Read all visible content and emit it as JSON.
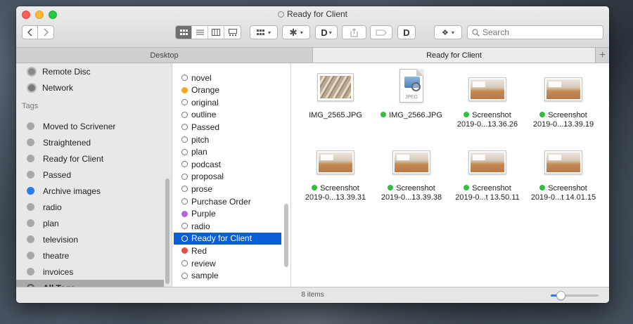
{
  "window": {
    "title": "Ready for Client"
  },
  "toolbar": {
    "back_icon": "chevron-left-icon",
    "forward_icon": "chevron-right-icon",
    "view_modes": [
      "icon-view",
      "list-view",
      "column-view",
      "gallery-view"
    ],
    "active_view": "icon-view",
    "search": {
      "placeholder": "Search",
      "value": ""
    }
  },
  "tabs": [
    {
      "label": "Desktop",
      "active": false
    },
    {
      "label": "Ready for Client",
      "active": true
    }
  ],
  "sidebar": {
    "top_items": [
      {
        "label": "Remote Disc",
        "icon": "disc-icon"
      },
      {
        "label": "Network",
        "icon": "globe-icon"
      }
    ],
    "tags_header": "Tags",
    "tags": [
      {
        "label": "Moved to Scrivener",
        "color": "#a8a8a8"
      },
      {
        "label": "Straightened",
        "color": "#a8a8a8"
      },
      {
        "label": "Ready for Client",
        "color": "#a8a8a8"
      },
      {
        "label": "Passed",
        "color": "#a8a8a8"
      },
      {
        "label": "Archive images",
        "color": "#2f7ae5"
      },
      {
        "label": "radio",
        "color": "#a8a8a8"
      },
      {
        "label": "plan",
        "color": "#a8a8a8"
      },
      {
        "label": "television",
        "color": "#a8a8a8"
      },
      {
        "label": "theatre",
        "color": "#a8a8a8"
      },
      {
        "label": "invoices",
        "color": "#a8a8a8"
      },
      {
        "label": "All Tags...",
        "color": "#777777",
        "selected": true
      }
    ]
  },
  "tag_list": [
    {
      "label": "novel",
      "color": ""
    },
    {
      "label": "Orange",
      "color": "#f5a623"
    },
    {
      "label": "original",
      "color": ""
    },
    {
      "label": "outline",
      "color": ""
    },
    {
      "label": "Passed",
      "color": ""
    },
    {
      "label": "pitch",
      "color": ""
    },
    {
      "label": "plan",
      "color": ""
    },
    {
      "label": "podcast",
      "color": ""
    },
    {
      "label": "proposal",
      "color": ""
    },
    {
      "label": "prose",
      "color": ""
    },
    {
      "label": "Purchase Order",
      "color": ""
    },
    {
      "label": "Purple",
      "color": "#b463d9"
    },
    {
      "label": "radio",
      "color": ""
    },
    {
      "label": "Ready for Client",
      "color": "",
      "selected": true
    },
    {
      "label": "Red",
      "color": "#f04a3e"
    },
    {
      "label": "review",
      "color": ""
    },
    {
      "label": "sample",
      "color": ""
    }
  ],
  "files": [
    {
      "line1": "IMG_2565.JPG",
      "line2": "",
      "tagged": false,
      "kind": "photo"
    },
    {
      "line1": "IMG_2566.JPG",
      "line2": "",
      "tagged": true,
      "kind": "jpeg-doc"
    },
    {
      "line1": "Screenshot",
      "line2": "2019-0...13.36.26",
      "tagged": true,
      "kind": "screenshot"
    },
    {
      "line1": "Screenshot",
      "line2": "2019-0...13.39.19",
      "tagged": true,
      "kind": "screenshot"
    },
    {
      "line1": "Screenshot",
      "line2": "2019-0...13.39.31",
      "tagged": true,
      "kind": "screenshot"
    },
    {
      "line1": "Screenshot",
      "line2": "2019-0...13.39.38",
      "tagged": true,
      "kind": "screenshot"
    },
    {
      "line1": "Screenshot",
      "line2": "2019-0...t 13.50.11",
      "tagged": true,
      "kind": "screenshot"
    },
    {
      "line1": "Screenshot",
      "line2": "2019-0...t 14.01.15",
      "tagged": true,
      "kind": "screenshot"
    }
  ],
  "jpeg_label": "JPEG",
  "status": {
    "item_count": "8 items",
    "zoom_level": 0.2
  },
  "colors": {
    "tag_green": "#2fbf3e",
    "selection_blue": "#0a5fd6"
  }
}
